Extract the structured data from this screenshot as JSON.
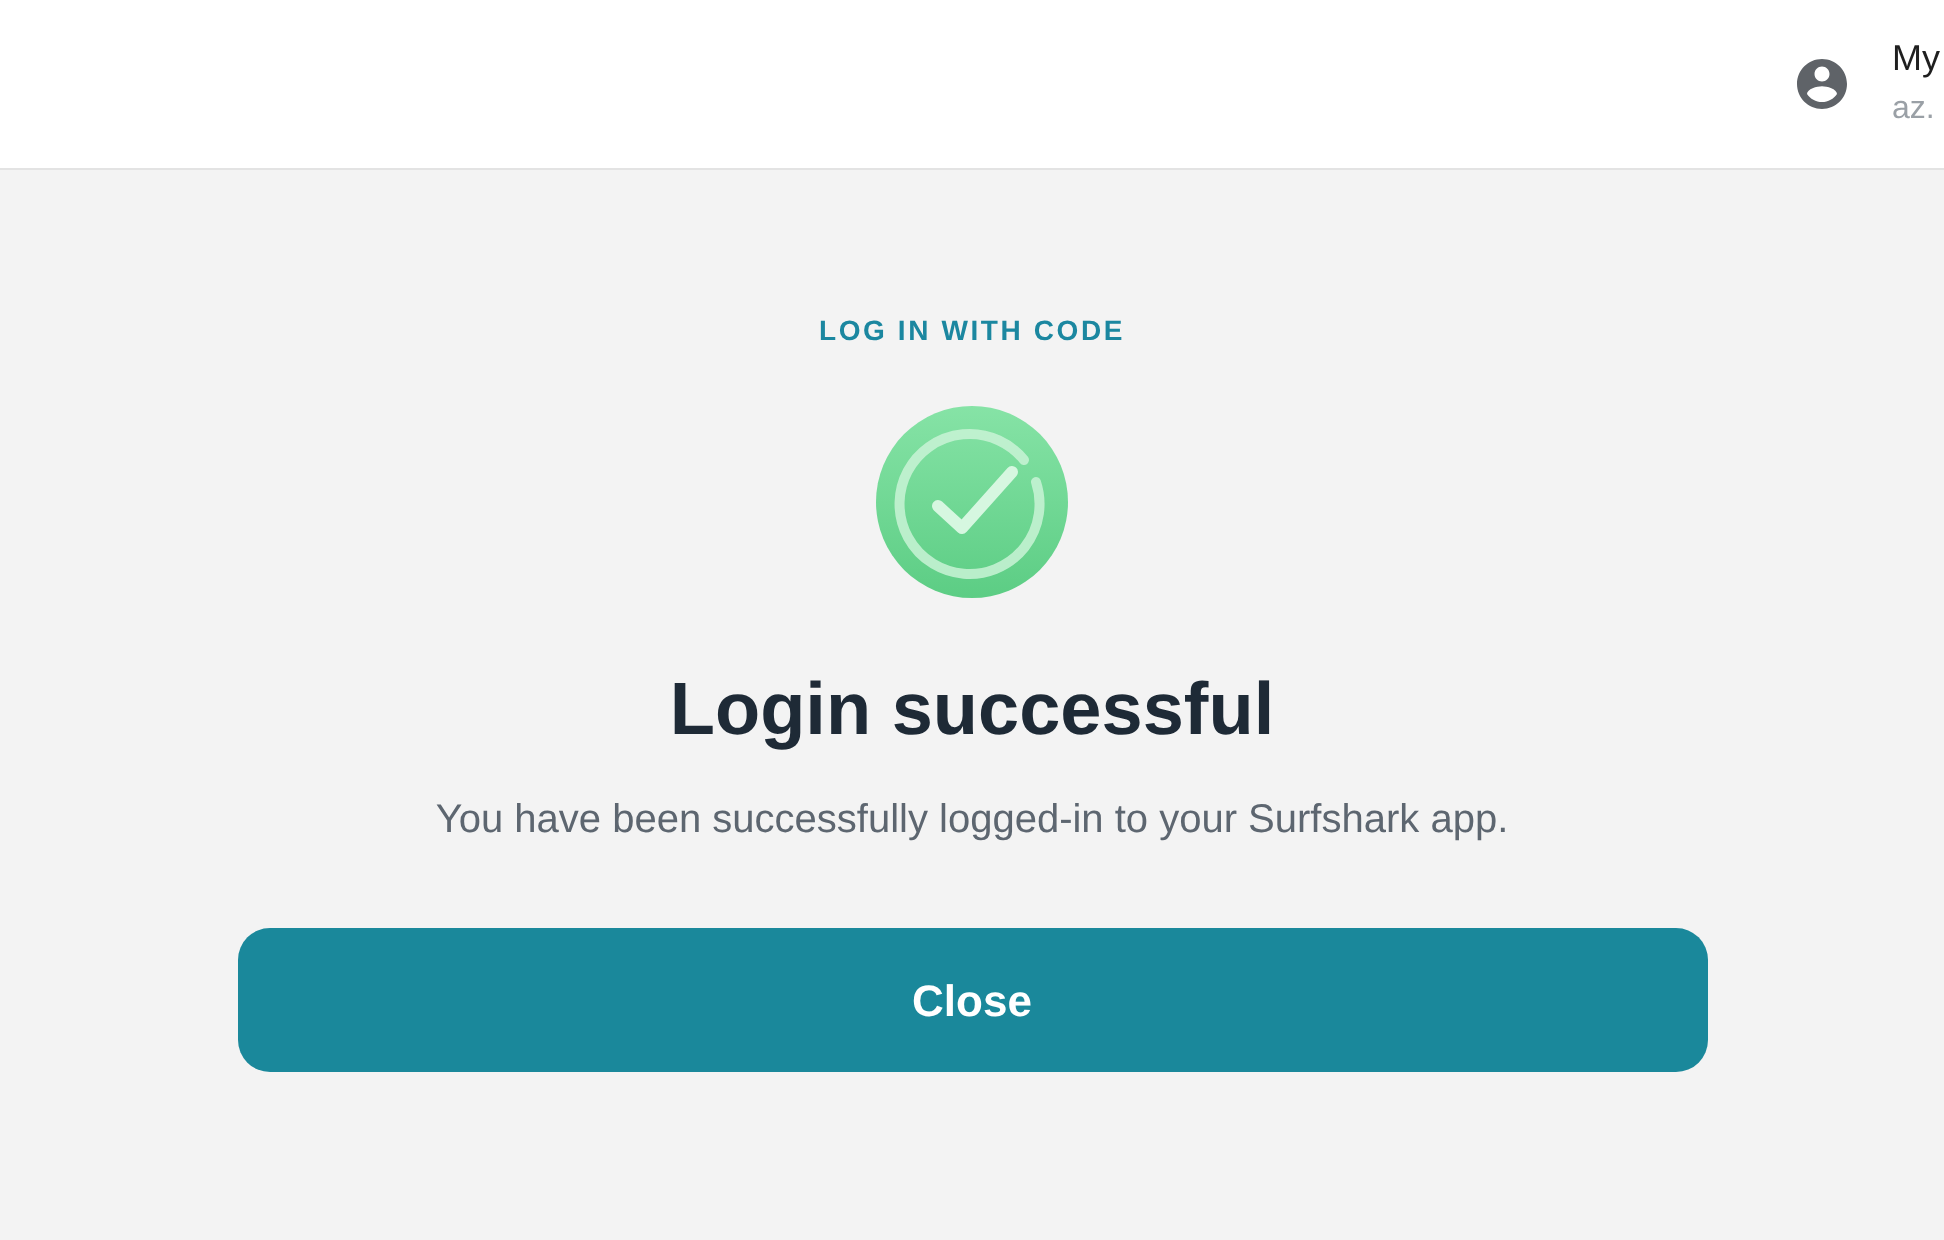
{
  "header": {
    "account": {
      "label": "My",
      "sublabel": "az."
    }
  },
  "card": {
    "eyebrow": "LOG IN WITH CODE",
    "title": "Login successful",
    "message": "You have been successfully logged-in to your Surfshark app.",
    "button": "Close"
  }
}
